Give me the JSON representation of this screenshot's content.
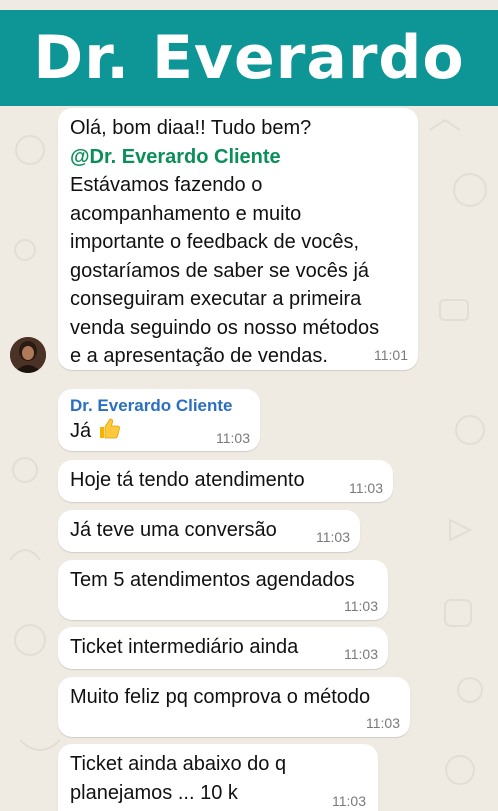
{
  "header": {
    "title": "Dr. Everardo"
  },
  "messages": [
    {
      "lines": [
        "Olá, bom diaa!! Tudo bem?",
        "@Dr. Everardo Cliente",
        "Estávamos fazendo o",
        "acompanhamento e muito",
        "importante o feedback de vocês,",
        "gostaríamos de saber se vocês já",
        "conseguiram executar a primeira",
        "venda seguindo os nosso métodos",
        "e a apresentação de vendas."
      ],
      "time": "11:01"
    },
    {
      "sender": "Dr. Everardo Cliente",
      "text": "Já",
      "time": "11:03"
    },
    {
      "text": "Hoje tá tendo atendimento",
      "time": "11:03"
    },
    {
      "text": "Já teve uma conversão",
      "time": "11:03"
    },
    {
      "text": "Tem 5 atendimentos agendados",
      "time": "11:03"
    },
    {
      "text": "Ticket intermediário ainda",
      "time": "11:03"
    },
    {
      "text": "Muito feliz pq comprova o método",
      "time": "11:03"
    },
    {
      "lines": [
        "Ticket ainda abaixo do q",
        "planejamos ... 10 k"
      ],
      "time": "11:03"
    }
  ],
  "icons": {
    "thumbs_up": "thumbs-up-emoji",
    "avatar": "contact-avatar"
  },
  "colors": {
    "header": "#0e9596",
    "mention": "#0b8f5a",
    "sender": "#2a6fc2",
    "chat_background": "#efeae2"
  }
}
